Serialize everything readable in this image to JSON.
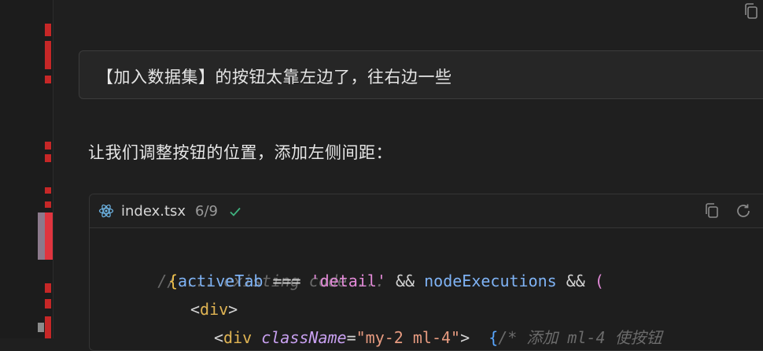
{
  "user_message": "【加入数据集】的按钮太靠左边了，往右边一些",
  "assistant_message": "让我们调整按钮的位置，添加左侧间距：",
  "code_block": {
    "file_name": "index.tsx",
    "progress": "6/9",
    "icons": [
      "react-icon",
      "check-icon",
      "copy-icon",
      "refresh-icon"
    ],
    "lines": {
      "l1": "// ... existing code ...",
      "l2_brace": "{",
      "l2_var": "activeTab",
      "l2_op1": " === ",
      "l2_str": "'detail'",
      "l2_op2": " && ",
      "l2_var2": "nodeExecutions",
      "l2_op3": " && ",
      "l2_paren": "(",
      "l3_lt": "<",
      "l3_tag": "div",
      "l3_gt": ">",
      "l4_lt": "<",
      "l4_tag": "div",
      "l4_attr": " className",
      "l4_eq": "=",
      "l4_val": "\"my-2 ml-4\"",
      "l4_gt": ">",
      "l4_jsx": "  {",
      "l4_comment": "/* 添加 ml-4 使按钮"
    }
  },
  "colors": {
    "background": "#1f1f1f",
    "gutter_mark_red": "#d42a2a",
    "gutter_mark_gray": "#8b8b8b",
    "accent_blue": "#58a6ff"
  }
}
